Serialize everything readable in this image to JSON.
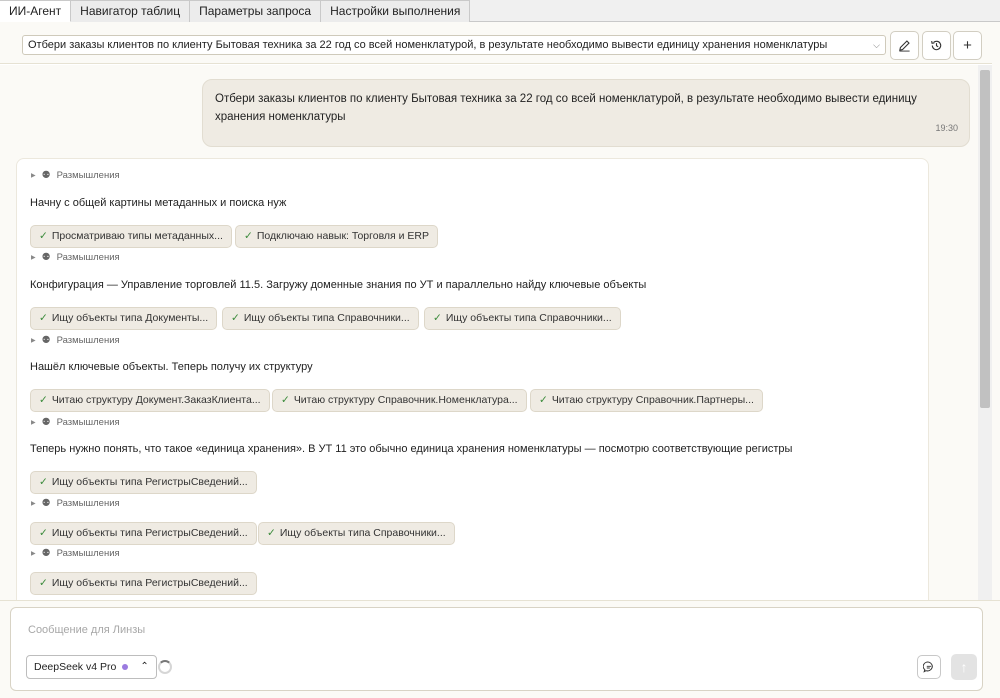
{
  "tabs": [
    {
      "label": "ИИ-Агент"
    },
    {
      "label": "Навигатор таблиц"
    },
    {
      "label": "Параметры запроса"
    },
    {
      "label": "Настройки выполнения"
    }
  ],
  "query": {
    "selected": "Отбери заказы клиентов по клиенту Бытовая техника за 22 год со всей номенклатурой, в результате необходимо вывести единицу хранения номенклатуры",
    "icons": {
      "edit": "pencil-icon",
      "history": "history-icon",
      "add": "plus-icon"
    }
  },
  "user_message": {
    "text": "Отбери заказы клиентов по клиенту Бытовая техника за 22 год со всей номенклатурой, в результате необходимо вывести единицу хранения номенклатуры",
    "time": "19:30"
  },
  "agent": {
    "thinking_label": "Размышления",
    "messages": [
      "Начну с общей картины метаданных и поиска нуж",
      "Конфигурация — Управление торговлей 11.5. Загружу доменные знания по УТ и параллельно найду ключевые объекты",
      "Нашёл ключевые объекты. Теперь получу их структуру",
      "Теперь нужно понять, что такое «единица хранения». В УТ 11 это обычно единица хранения номенклатуры — посмотрю соответствующие регистры"
    ],
    "chip_groups": [
      [
        "Просматриваю типы метаданных...",
        "Подключаю навык: Торговля и ERP"
      ],
      [
        "Ищу объекты типа Документы...",
        "Ищу объекты типа Справочники...",
        "Ищу объекты типа Справочники..."
      ],
      [
        "Читаю структуру Документ.ЗаказКлиента...",
        "Читаю структуру Справочник.Номенклатура...",
        "Читаю структуру Справочник.Партнеры..."
      ],
      [
        "Ищу объекты типа РегистрыСведений..."
      ],
      [
        "Ищу объекты типа РегистрыСведений...",
        "Ищу объекты типа Справочники..."
      ],
      [
        "Ищу объекты типа РегистрыСведений..."
      ]
    ],
    "check_mark": "✓"
  },
  "composer": {
    "placeholder": "Сообщение для Линзы",
    "model": "DeepSeek v4 Pro",
    "model_color": "#9b7be0"
  }
}
